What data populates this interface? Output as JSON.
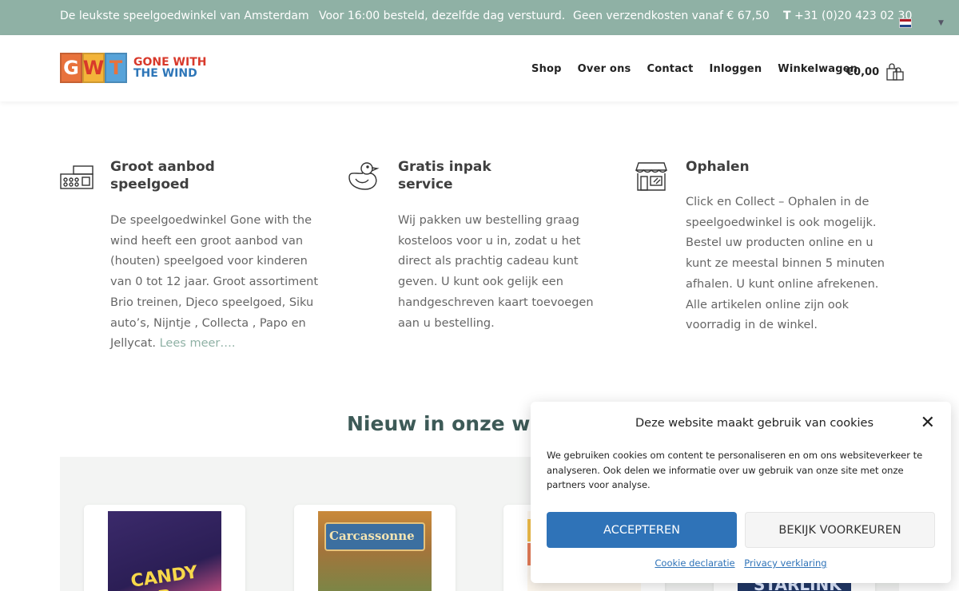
{
  "topbar": {
    "msg1": "De leukste speelgoedwinkel van Amsterdam",
    "msg2": "Voor 16:00 besteld, dezelfde dag verstuurd.",
    "msg3": "Geen verzendkosten vanaf € 67,50",
    "phone_prefix": "T",
    "phone": "+31 (0)20 423 02 30"
  },
  "logo": {
    "l1": "G",
    "l2": "W",
    "l3": "T",
    "line1": "GONE WITH",
    "line2": "THE WIND"
  },
  "nav": {
    "shop": "Shop",
    "over": "Over ons",
    "contact": "Contact",
    "login": "Inloggen",
    "cart": "Winkelwagen"
  },
  "cart": {
    "amount": "€0,00"
  },
  "features": [
    {
      "title_l1": "Groot aanbod",
      "title_l2": "speelgoed",
      "text": "De speelgoedwinkel Gone with the wind heeft een groot aanbod van (houten) speelgoed voor kinderen van 0 tot 12 jaar. Groot assortiment Brio treinen, Djeco speelgoed, Siku auto’s, Nijntje , Collecta , Papo en Jellycat. ",
      "link": "Lees meer…."
    },
    {
      "title_l1": "Gratis inpak",
      "title_l2": "service",
      "text": "Wij pakken uw bestelling graag kosteloos voor u in, zodat u het direct als prachtig cadeau kunt geven. U kunt ook gelijk een handgeschreven kaart toevoegen aan u bestelling."
    },
    {
      "title_l1": "Ophalen",
      "text": "Click en Collect – Ophalen in de speelgoedwinkel is ook mogelijk. Bestel uw producten online en u kunt ze meestal binnen 5 minuten afhalen. U kunt online afrekenen. Alle artikelen online zijn ook voorradig in de winkel."
    }
  ],
  "section": {
    "title": "Nieuw in onze webshop"
  },
  "products": [
    {
      "label": "CANDY LAB"
    },
    {
      "label": "Carcassonne"
    },
    {
      "label": ""
    },
    {
      "label": "STARLINK"
    }
  ],
  "cookie": {
    "title": "Deze website maakt gebruik van cookies",
    "text": "We gebruiken cookies om content te personaliseren en om ons websiteverkeer te analyseren. Ook delen we informatie over uw gebruik van onze site met onze partners voor analyse.",
    "accept": "ACCEPTEREN",
    "prefs": "BEKIJK VOORKEUREN",
    "link1": "Cookie declaratie",
    "link2": "Privacy verklaring"
  }
}
